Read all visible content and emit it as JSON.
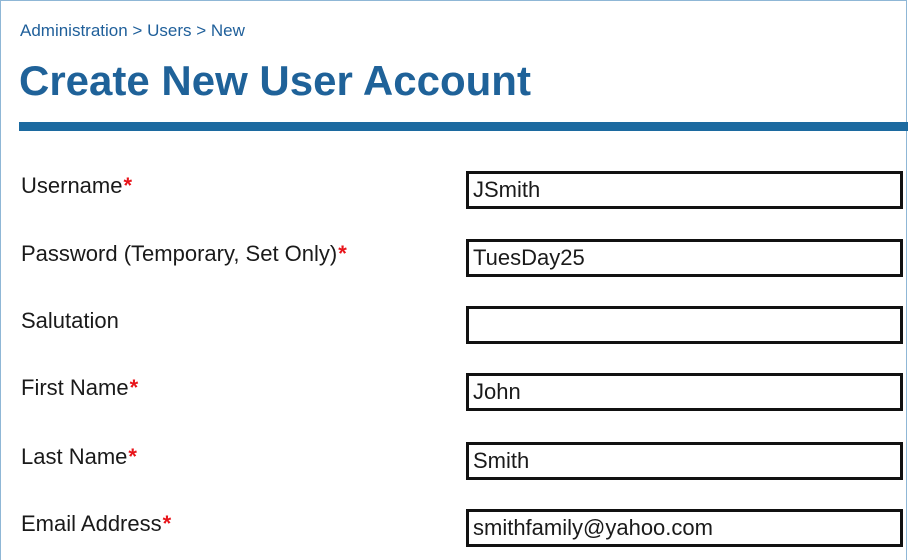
{
  "breadcrumb": "Administration > Users > New",
  "title": "Create New User Account",
  "required_mark": "*",
  "fields": [
    {
      "label": "Username",
      "required": true,
      "value": "JSmith"
    },
    {
      "label": "Password (Temporary, Set Only)",
      "required": true,
      "value": "TuesDay25"
    },
    {
      "label": "Salutation",
      "required": false,
      "value": ""
    },
    {
      "label": "First Name",
      "required": true,
      "value": "John"
    },
    {
      "label": "Last Name",
      "required": true,
      "value": "Smith"
    },
    {
      "label": "Email Address",
      "required": true,
      "value": "smithfamily@yahoo.com"
    }
  ],
  "colors": {
    "heading": "#1f6299",
    "rule": "#1c6aa0",
    "required": "#e8141a",
    "input_border": "#111111"
  }
}
